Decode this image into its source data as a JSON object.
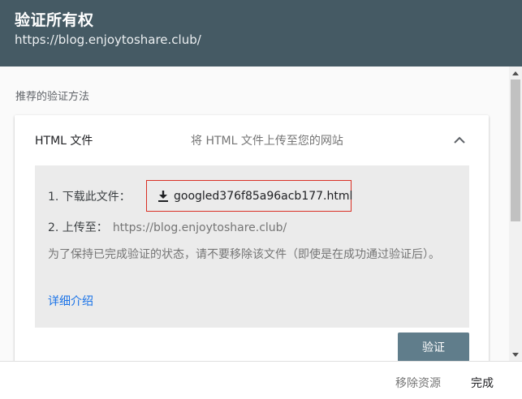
{
  "header": {
    "title": "验证所有权",
    "url": "https://blog.enjoytoshare.club/"
  },
  "section_label": "推荐的验证方法",
  "card": {
    "title": "HTML 文件",
    "description": "将 HTML 文件上传至您的网站",
    "step1_label": "1. 下载此文件：",
    "download_file": "googled376f85a96acb177.html",
    "step2_label": "2. 上传至：",
    "step2_url": "https://blog.enjoytoshare.club/",
    "note": "为了保持已完成验证的状态，请不要移除该文件（即使是在成功通过验证后）。",
    "more_link": "详细介绍",
    "verify_button": "验证"
  },
  "footer": {
    "remove_label": "移除资源",
    "done_label": "完成"
  },
  "icons": {
    "collapse": "chevron-up-icon",
    "download": "download-icon",
    "scroll_up": "scroll-up-arrow-icon",
    "scroll_down": "scroll-down-arrow-icon"
  },
  "colors": {
    "header_bg": "#455a64",
    "verify_button_bg": "#607d8b",
    "highlight_border": "#d93025",
    "link": "#1a73e8"
  }
}
